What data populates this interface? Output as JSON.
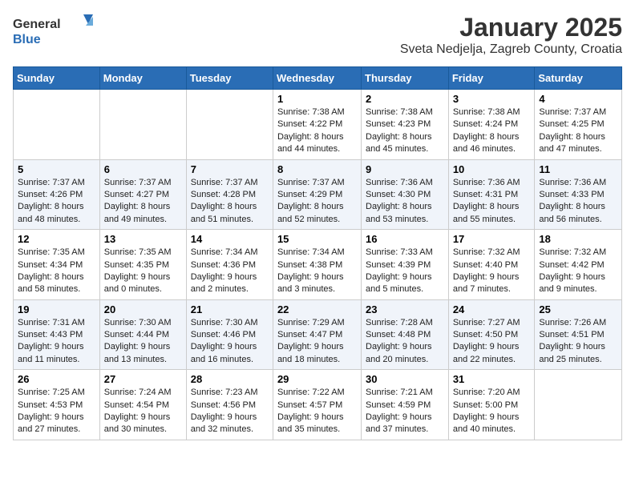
{
  "logo": {
    "general": "General",
    "blue": "Blue"
  },
  "title": "January 2025",
  "subtitle": "Sveta Nedjelja, Zagreb County, Croatia",
  "days_of_week": [
    "Sunday",
    "Monday",
    "Tuesday",
    "Wednesday",
    "Thursday",
    "Friday",
    "Saturday"
  ],
  "weeks": [
    [
      {
        "num": "",
        "info": ""
      },
      {
        "num": "",
        "info": ""
      },
      {
        "num": "",
        "info": ""
      },
      {
        "num": "1",
        "info": "Sunrise: 7:38 AM\nSunset: 4:22 PM\nDaylight: 8 hours and 44 minutes."
      },
      {
        "num": "2",
        "info": "Sunrise: 7:38 AM\nSunset: 4:23 PM\nDaylight: 8 hours and 45 minutes."
      },
      {
        "num": "3",
        "info": "Sunrise: 7:38 AM\nSunset: 4:24 PM\nDaylight: 8 hours and 46 minutes."
      },
      {
        "num": "4",
        "info": "Sunrise: 7:37 AM\nSunset: 4:25 PM\nDaylight: 8 hours and 47 minutes."
      }
    ],
    [
      {
        "num": "5",
        "info": "Sunrise: 7:37 AM\nSunset: 4:26 PM\nDaylight: 8 hours and 48 minutes."
      },
      {
        "num": "6",
        "info": "Sunrise: 7:37 AM\nSunset: 4:27 PM\nDaylight: 8 hours and 49 minutes."
      },
      {
        "num": "7",
        "info": "Sunrise: 7:37 AM\nSunset: 4:28 PM\nDaylight: 8 hours and 51 minutes."
      },
      {
        "num": "8",
        "info": "Sunrise: 7:37 AM\nSunset: 4:29 PM\nDaylight: 8 hours and 52 minutes."
      },
      {
        "num": "9",
        "info": "Sunrise: 7:36 AM\nSunset: 4:30 PM\nDaylight: 8 hours and 53 minutes."
      },
      {
        "num": "10",
        "info": "Sunrise: 7:36 AM\nSunset: 4:31 PM\nDaylight: 8 hours and 55 minutes."
      },
      {
        "num": "11",
        "info": "Sunrise: 7:36 AM\nSunset: 4:33 PM\nDaylight: 8 hours and 56 minutes."
      }
    ],
    [
      {
        "num": "12",
        "info": "Sunrise: 7:35 AM\nSunset: 4:34 PM\nDaylight: 8 hours and 58 minutes."
      },
      {
        "num": "13",
        "info": "Sunrise: 7:35 AM\nSunset: 4:35 PM\nDaylight: 9 hours and 0 minutes."
      },
      {
        "num": "14",
        "info": "Sunrise: 7:34 AM\nSunset: 4:36 PM\nDaylight: 9 hours and 2 minutes."
      },
      {
        "num": "15",
        "info": "Sunrise: 7:34 AM\nSunset: 4:38 PM\nDaylight: 9 hours and 3 minutes."
      },
      {
        "num": "16",
        "info": "Sunrise: 7:33 AM\nSunset: 4:39 PM\nDaylight: 9 hours and 5 minutes."
      },
      {
        "num": "17",
        "info": "Sunrise: 7:32 AM\nSunset: 4:40 PM\nDaylight: 9 hours and 7 minutes."
      },
      {
        "num": "18",
        "info": "Sunrise: 7:32 AM\nSunset: 4:42 PM\nDaylight: 9 hours and 9 minutes."
      }
    ],
    [
      {
        "num": "19",
        "info": "Sunrise: 7:31 AM\nSunset: 4:43 PM\nDaylight: 9 hours and 11 minutes."
      },
      {
        "num": "20",
        "info": "Sunrise: 7:30 AM\nSunset: 4:44 PM\nDaylight: 9 hours and 13 minutes."
      },
      {
        "num": "21",
        "info": "Sunrise: 7:30 AM\nSunset: 4:46 PM\nDaylight: 9 hours and 16 minutes."
      },
      {
        "num": "22",
        "info": "Sunrise: 7:29 AM\nSunset: 4:47 PM\nDaylight: 9 hours and 18 minutes."
      },
      {
        "num": "23",
        "info": "Sunrise: 7:28 AM\nSunset: 4:48 PM\nDaylight: 9 hours and 20 minutes."
      },
      {
        "num": "24",
        "info": "Sunrise: 7:27 AM\nSunset: 4:50 PM\nDaylight: 9 hours and 22 minutes."
      },
      {
        "num": "25",
        "info": "Sunrise: 7:26 AM\nSunset: 4:51 PM\nDaylight: 9 hours and 25 minutes."
      }
    ],
    [
      {
        "num": "26",
        "info": "Sunrise: 7:25 AM\nSunset: 4:53 PM\nDaylight: 9 hours and 27 minutes."
      },
      {
        "num": "27",
        "info": "Sunrise: 7:24 AM\nSunset: 4:54 PM\nDaylight: 9 hours and 30 minutes."
      },
      {
        "num": "28",
        "info": "Sunrise: 7:23 AM\nSunset: 4:56 PM\nDaylight: 9 hours and 32 minutes."
      },
      {
        "num": "29",
        "info": "Sunrise: 7:22 AM\nSunset: 4:57 PM\nDaylight: 9 hours and 35 minutes."
      },
      {
        "num": "30",
        "info": "Sunrise: 7:21 AM\nSunset: 4:59 PM\nDaylight: 9 hours and 37 minutes."
      },
      {
        "num": "31",
        "info": "Sunrise: 7:20 AM\nSunset: 5:00 PM\nDaylight: 9 hours and 40 minutes."
      },
      {
        "num": "",
        "info": ""
      }
    ]
  ]
}
